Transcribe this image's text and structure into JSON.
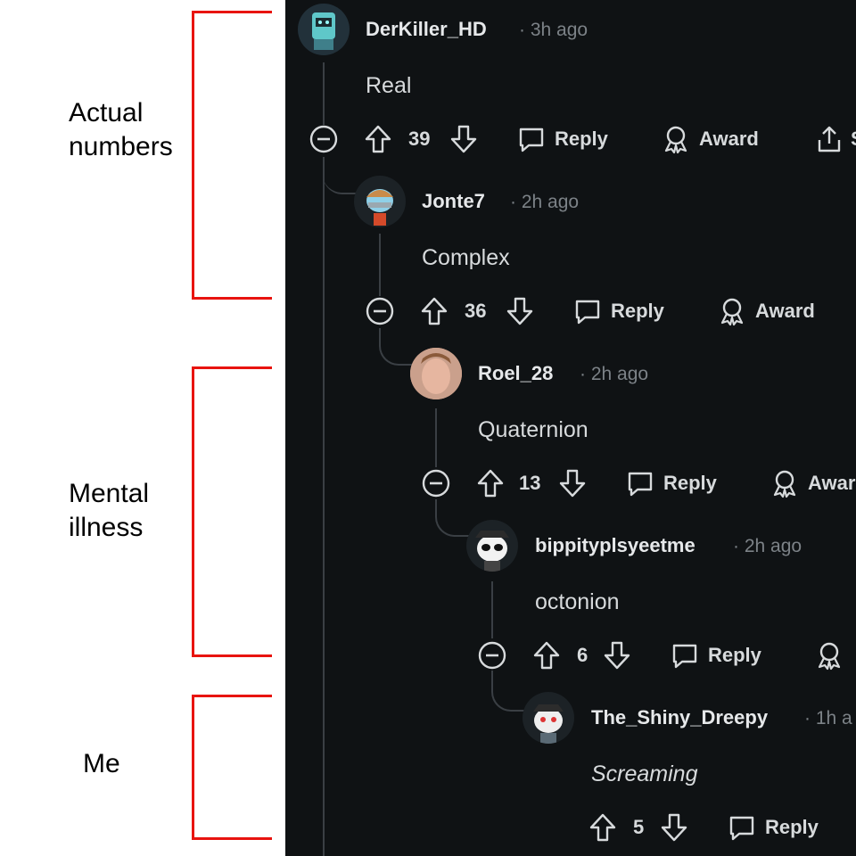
{
  "annotations": [
    {
      "label": "Actual\nnumbers"
    },
    {
      "label": "Mental\nillness"
    },
    {
      "label": "Me"
    }
  ],
  "colors": {
    "bracket": "#e8140f",
    "thread_bg": "#0f1214",
    "text": "#d7dadc",
    "meta": "#7c8287"
  },
  "comments": [
    {
      "username": "DerKiller_HD",
      "time": "· 3h ago",
      "body": "Real",
      "votes": "39",
      "reply": "Reply",
      "award": "Award",
      "share": "S",
      "avatar": "robot-avatar"
    },
    {
      "username": "Jonte7",
      "time": "· 2h ago",
      "body": "Complex",
      "votes": "36",
      "reply": "Reply",
      "award": "Award",
      "avatar": "snoo-avatar"
    },
    {
      "username": "Roel_28",
      "time": "· 2h ago",
      "body": "Quaternion",
      "votes": "13",
      "reply": "Reply",
      "award": "Awar",
      "avatar": "photo-avatar"
    },
    {
      "username": "bippityplsyeetme",
      "time": "· 2h ago",
      "body": "octonion",
      "votes": "6",
      "reply": "Reply",
      "award": "",
      "avatar": "panda-avatar"
    },
    {
      "username": "The_Shiny_Dreepy",
      "time": "· 1h a",
      "body": "Screaming",
      "votes": "5",
      "reply": "Reply",
      "avatar": "snoo-hat-avatar"
    }
  ]
}
